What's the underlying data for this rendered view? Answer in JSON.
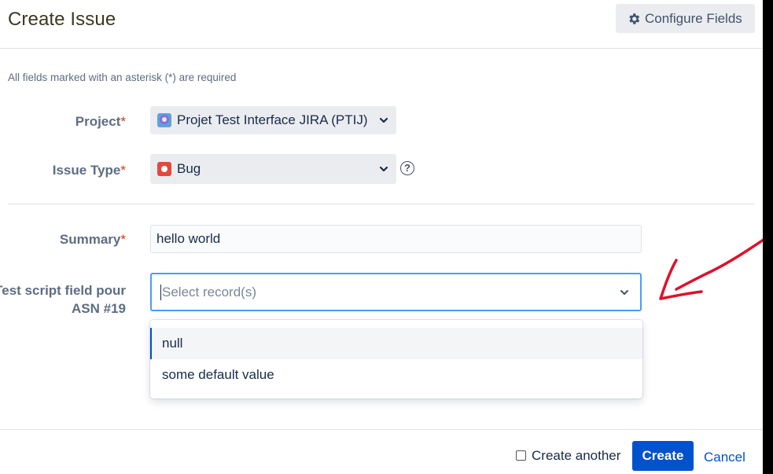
{
  "dialog": {
    "title": "Create Issue",
    "configure_fields_label": "Configure Fields",
    "required_note": "All fields marked with an asterisk (*) are required"
  },
  "fields": {
    "project": {
      "label": "Project",
      "asterisk": "*",
      "value": "Projet Test Interface JIRA (PTIJ)",
      "icon": "project-avatar-icon"
    },
    "issue_type": {
      "label": "Issue Type",
      "asterisk": "*",
      "value": "Bug",
      "icon": "bug-icon",
      "help_glyph": "?"
    },
    "summary": {
      "label": "Summary",
      "asterisk": "*",
      "value": "hello world"
    },
    "test_script": {
      "label_line1": "Test script field pour",
      "label_line2": "ASN #19",
      "placeholder": "Select record(s)",
      "options": [
        "null",
        "some default value"
      ]
    }
  },
  "footer": {
    "create_another_label": "Create another",
    "create_label": "Create",
    "cancel_label": "Cancel"
  },
  "colors": {
    "primary": "#0052cc",
    "focus_border": "#4c9aff",
    "required": "#de350b",
    "annotation": "#e0102a"
  }
}
